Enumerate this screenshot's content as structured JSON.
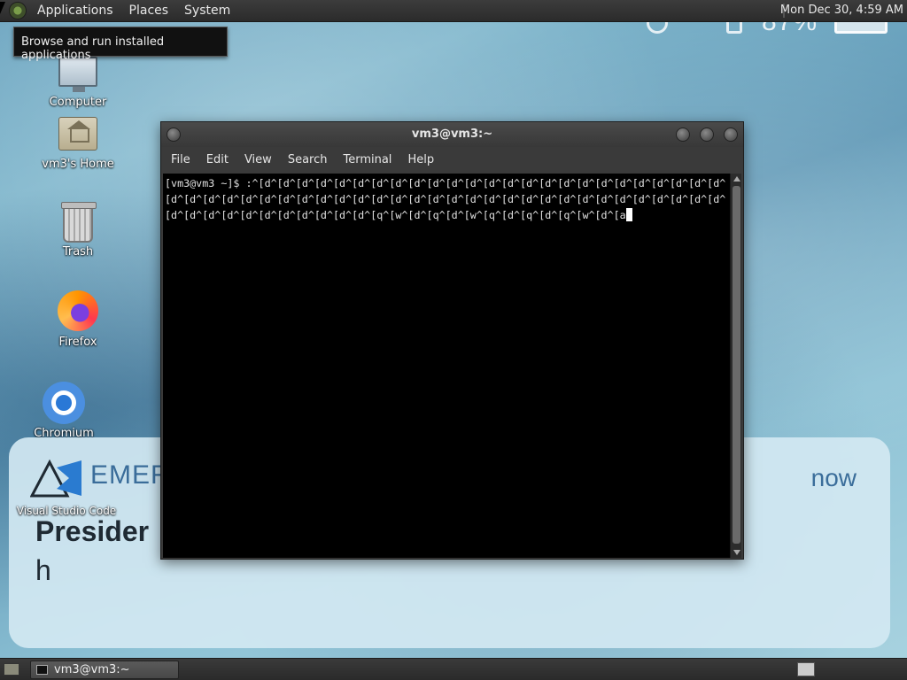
{
  "top_panel": {
    "menus": [
      "Applications",
      "Places",
      "System"
    ],
    "clock": "Mon Dec 30,  4:59 AM"
  },
  "tooltip": "Browse and run installed applications",
  "desktop_icons": [
    {
      "label": "Computer"
    },
    {
      "label": "vm3's Home"
    },
    {
      "label": "Trash"
    },
    {
      "label": "Firefox"
    },
    {
      "label": "Chromium"
    },
    {
      "label": "Visual Studio Code"
    }
  ],
  "background_notification": {
    "brand": "EMER",
    "time": "now",
    "title": "Presider",
    "body": "h",
    "tray_battery": "87%"
  },
  "terminal": {
    "title": "vm3@vm3:~",
    "menus": [
      "File",
      "Edit",
      "View",
      "Search",
      "Terminal",
      "Help"
    ],
    "prompt": "[vm3@vm3 ~]$ ",
    "input": ":^[d^[d^[d^[d^[d^[d^[d^[d^[d^[d^[d^[d^[d^[d^[d^[d^[d^[d^[d^[d^[d^[d^[d^[d^[d^[d^[d^[d^[d^[d^[d^[d^[d^[d^[d^[d^[d^[d^[d^[d^[d^[d^[d^[d^[d^[d^[d^[d^[d^[d^[d^[d^[d^[d^[d^[d^[d^[d^[d^[d^[d^[d^[d^[d^[d^[d^[q^[w^[d^[q^[d^[w^[q^[d^[q^[d^[q^[w^[d^[a"
  },
  "bottom_panel": {
    "task_label": "vm3@vm3:~"
  },
  "colors": {
    "panel": "#2b2b2b",
    "terminal_bg": "#000000",
    "terminal_fg": "#e0e0e0",
    "notification_accent": "#3a6d9a"
  }
}
